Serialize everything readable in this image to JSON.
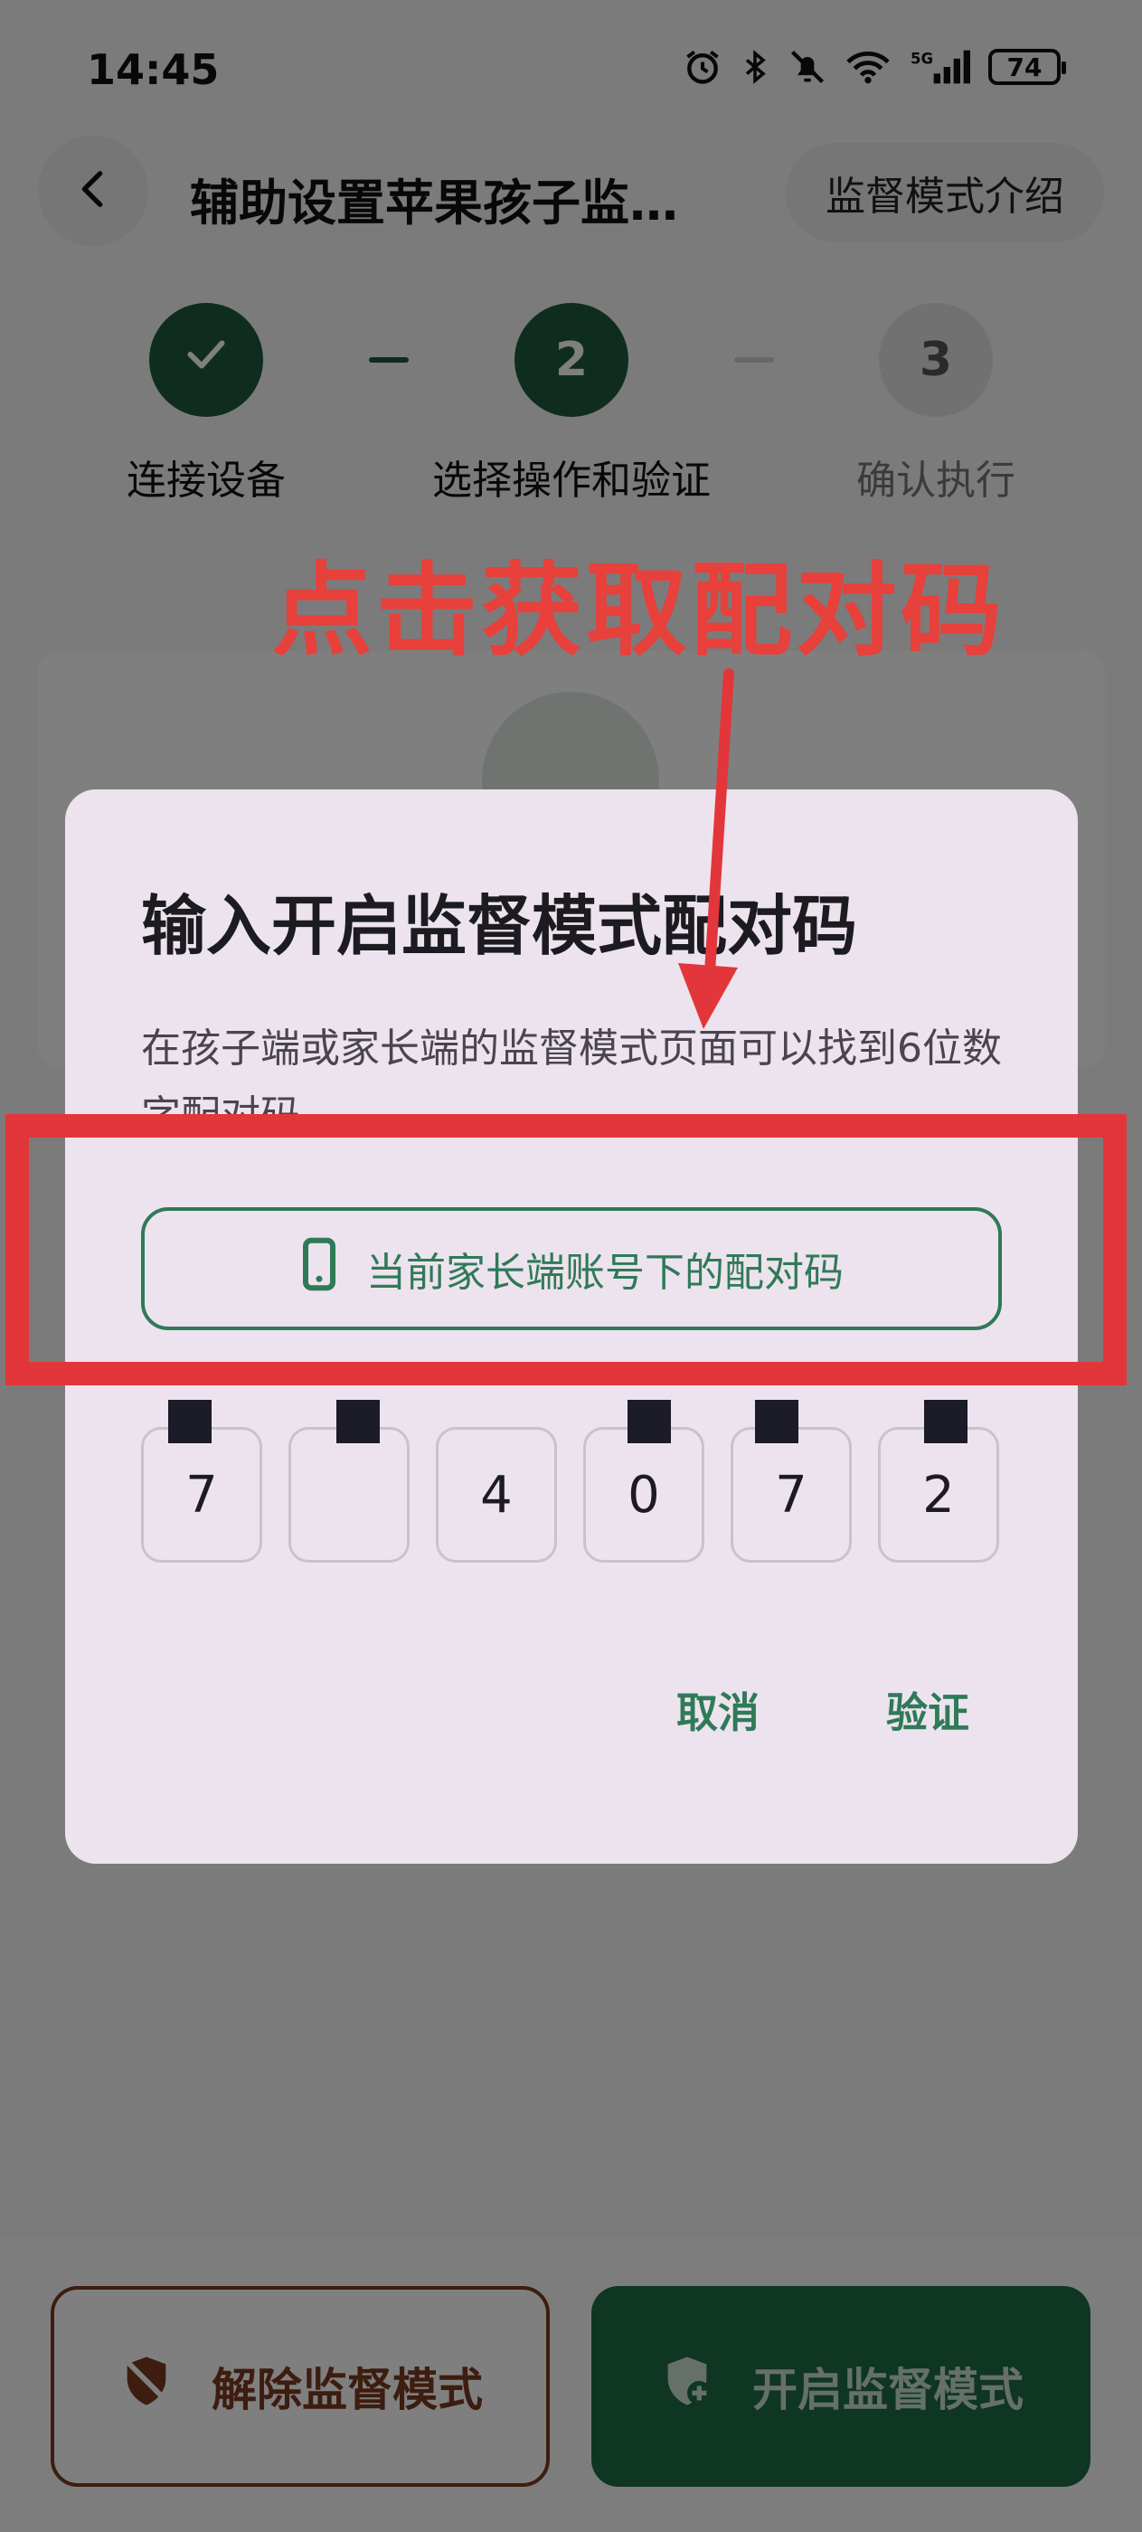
{
  "status_bar": {
    "time": "14:45",
    "battery": "74",
    "network": "5G"
  },
  "header": {
    "title": "辅助设置苹果孩子监…",
    "intro_button": "监督模式介绍"
  },
  "stepper": {
    "steps": [
      {
        "number": "1",
        "label": "连接设备",
        "state": "done"
      },
      {
        "number": "2",
        "label": "选择操作和验证",
        "state": "active"
      },
      {
        "number": "3",
        "label": "确认执行",
        "state": "todo"
      }
    ]
  },
  "dialog": {
    "title": "输入开启监督模式配对码",
    "description": "在孩子端或家长端的监督模式页面可以找到6位数字配对码",
    "pair_button": "当前家长端账号下的配对码",
    "code_digits": [
      "7",
      "",
      "4",
      "0",
      "7",
      "2"
    ],
    "cancel": "取消",
    "verify": "验证"
  },
  "bottom": {
    "unlock_button": "解除监督模式",
    "enable_button": "开启监督模式"
  },
  "annotation": {
    "text": "点击获取配对码",
    "color": "#e3363a"
  },
  "colors": {
    "brand_green": "#1f5a3e",
    "accent_green": "#2f7a58",
    "danger_brown": "#7a3a1f"
  }
}
